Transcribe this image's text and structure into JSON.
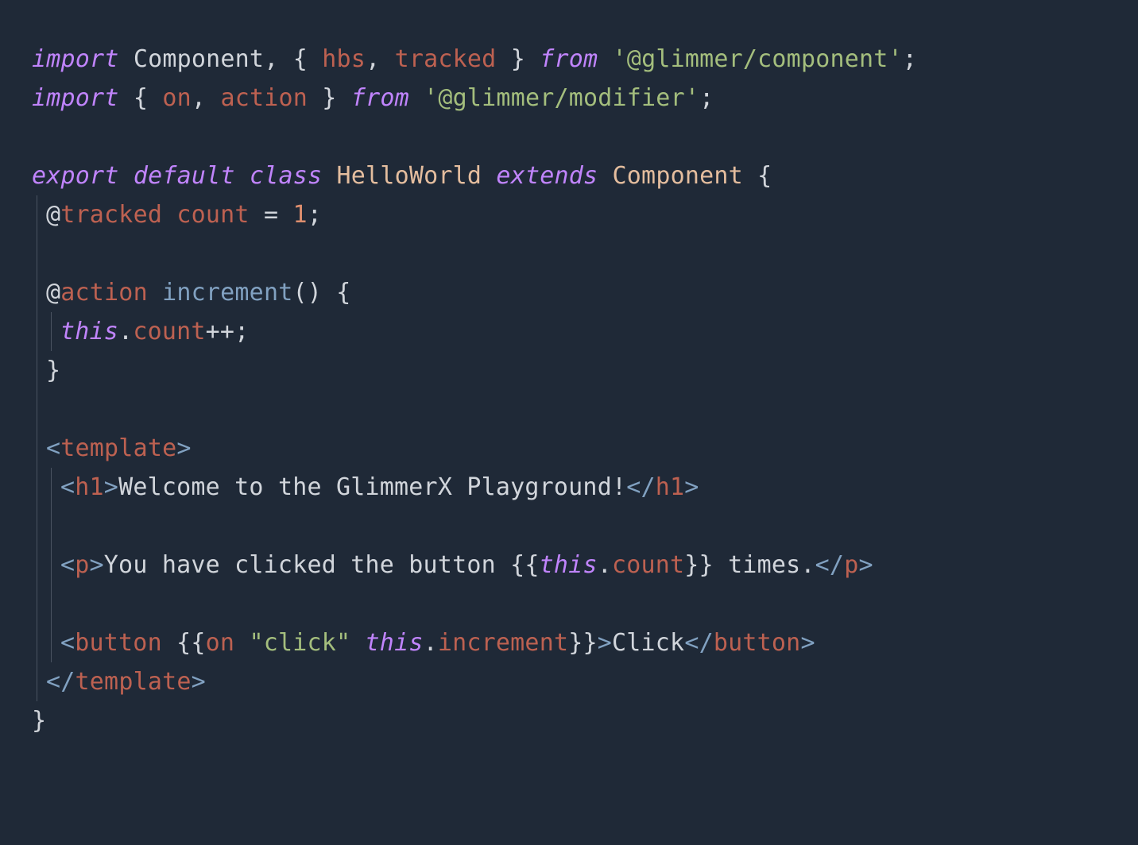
{
  "code": {
    "line1": {
      "import": "import",
      "Component": "Component",
      "comma1": ",",
      "oc": "{",
      "hbs": "hbs",
      "comma2": ",",
      "tracked": "tracked",
      "cc": "}",
      "from": "from",
      "str1": "'@glimmer/component'",
      "semi": ";"
    },
    "line2": {
      "import": "import",
      "oc": "{",
      "on": "on",
      "comma": ",",
      "action": "action",
      "cc": "}",
      "from": "from",
      "str1": "'@glimmer/modifier'",
      "semi": ";"
    },
    "line4": {
      "export": "export",
      "default": "default",
      "class": "class",
      "HelloWorld": "HelloWorld",
      "extends": "extends",
      "Component": "Component",
      "oc": "{"
    },
    "line5": {
      "at": "@",
      "tracked": "tracked",
      "count": "count",
      "eq": "=",
      "one": "1",
      "semi": ";"
    },
    "line7": {
      "at": "@",
      "action": "action",
      "increment": "increment",
      "paren": "()",
      "oc": "{"
    },
    "line8": {
      "this": "this",
      "dot": ".",
      "count": "count",
      "pp": "++",
      "semi": ";"
    },
    "line9": {
      "cc": "}"
    },
    "line11": {
      "lt": "<",
      "template": "template",
      "gt": ">"
    },
    "line12": {
      "lt": "<",
      "h1": "h1",
      "gt": ">",
      "text": "Welcome to the GlimmerX Playground!",
      "lte": "</",
      "h1e": "h1",
      "gte": ">"
    },
    "line14": {
      "lt": "<",
      "p": "p",
      "gt": ">",
      "t1": "You have clicked the button ",
      "oo": "{{",
      "this": "this",
      "dot": ".",
      "count": "count",
      "cc2": "}}",
      "t2": " times.",
      "lte": "</",
      "pe": "p",
      "gte": ">"
    },
    "line16": {
      "lt": "<",
      "button": "button",
      "sp": " ",
      "oo": "{{",
      "on": "on",
      "sp2": " ",
      "click": "\"click\"",
      "sp3": " ",
      "this": "this",
      "dot": ".",
      "inc": "increment",
      "cc2": "}}",
      "gt": ">",
      "text": "Click",
      "lte": "</",
      "buttone": "button",
      "gte": ">"
    },
    "line17": {
      "lte": "</",
      "template": "template",
      "gte": ">"
    },
    "line18": {
      "cc": "}"
    }
  }
}
